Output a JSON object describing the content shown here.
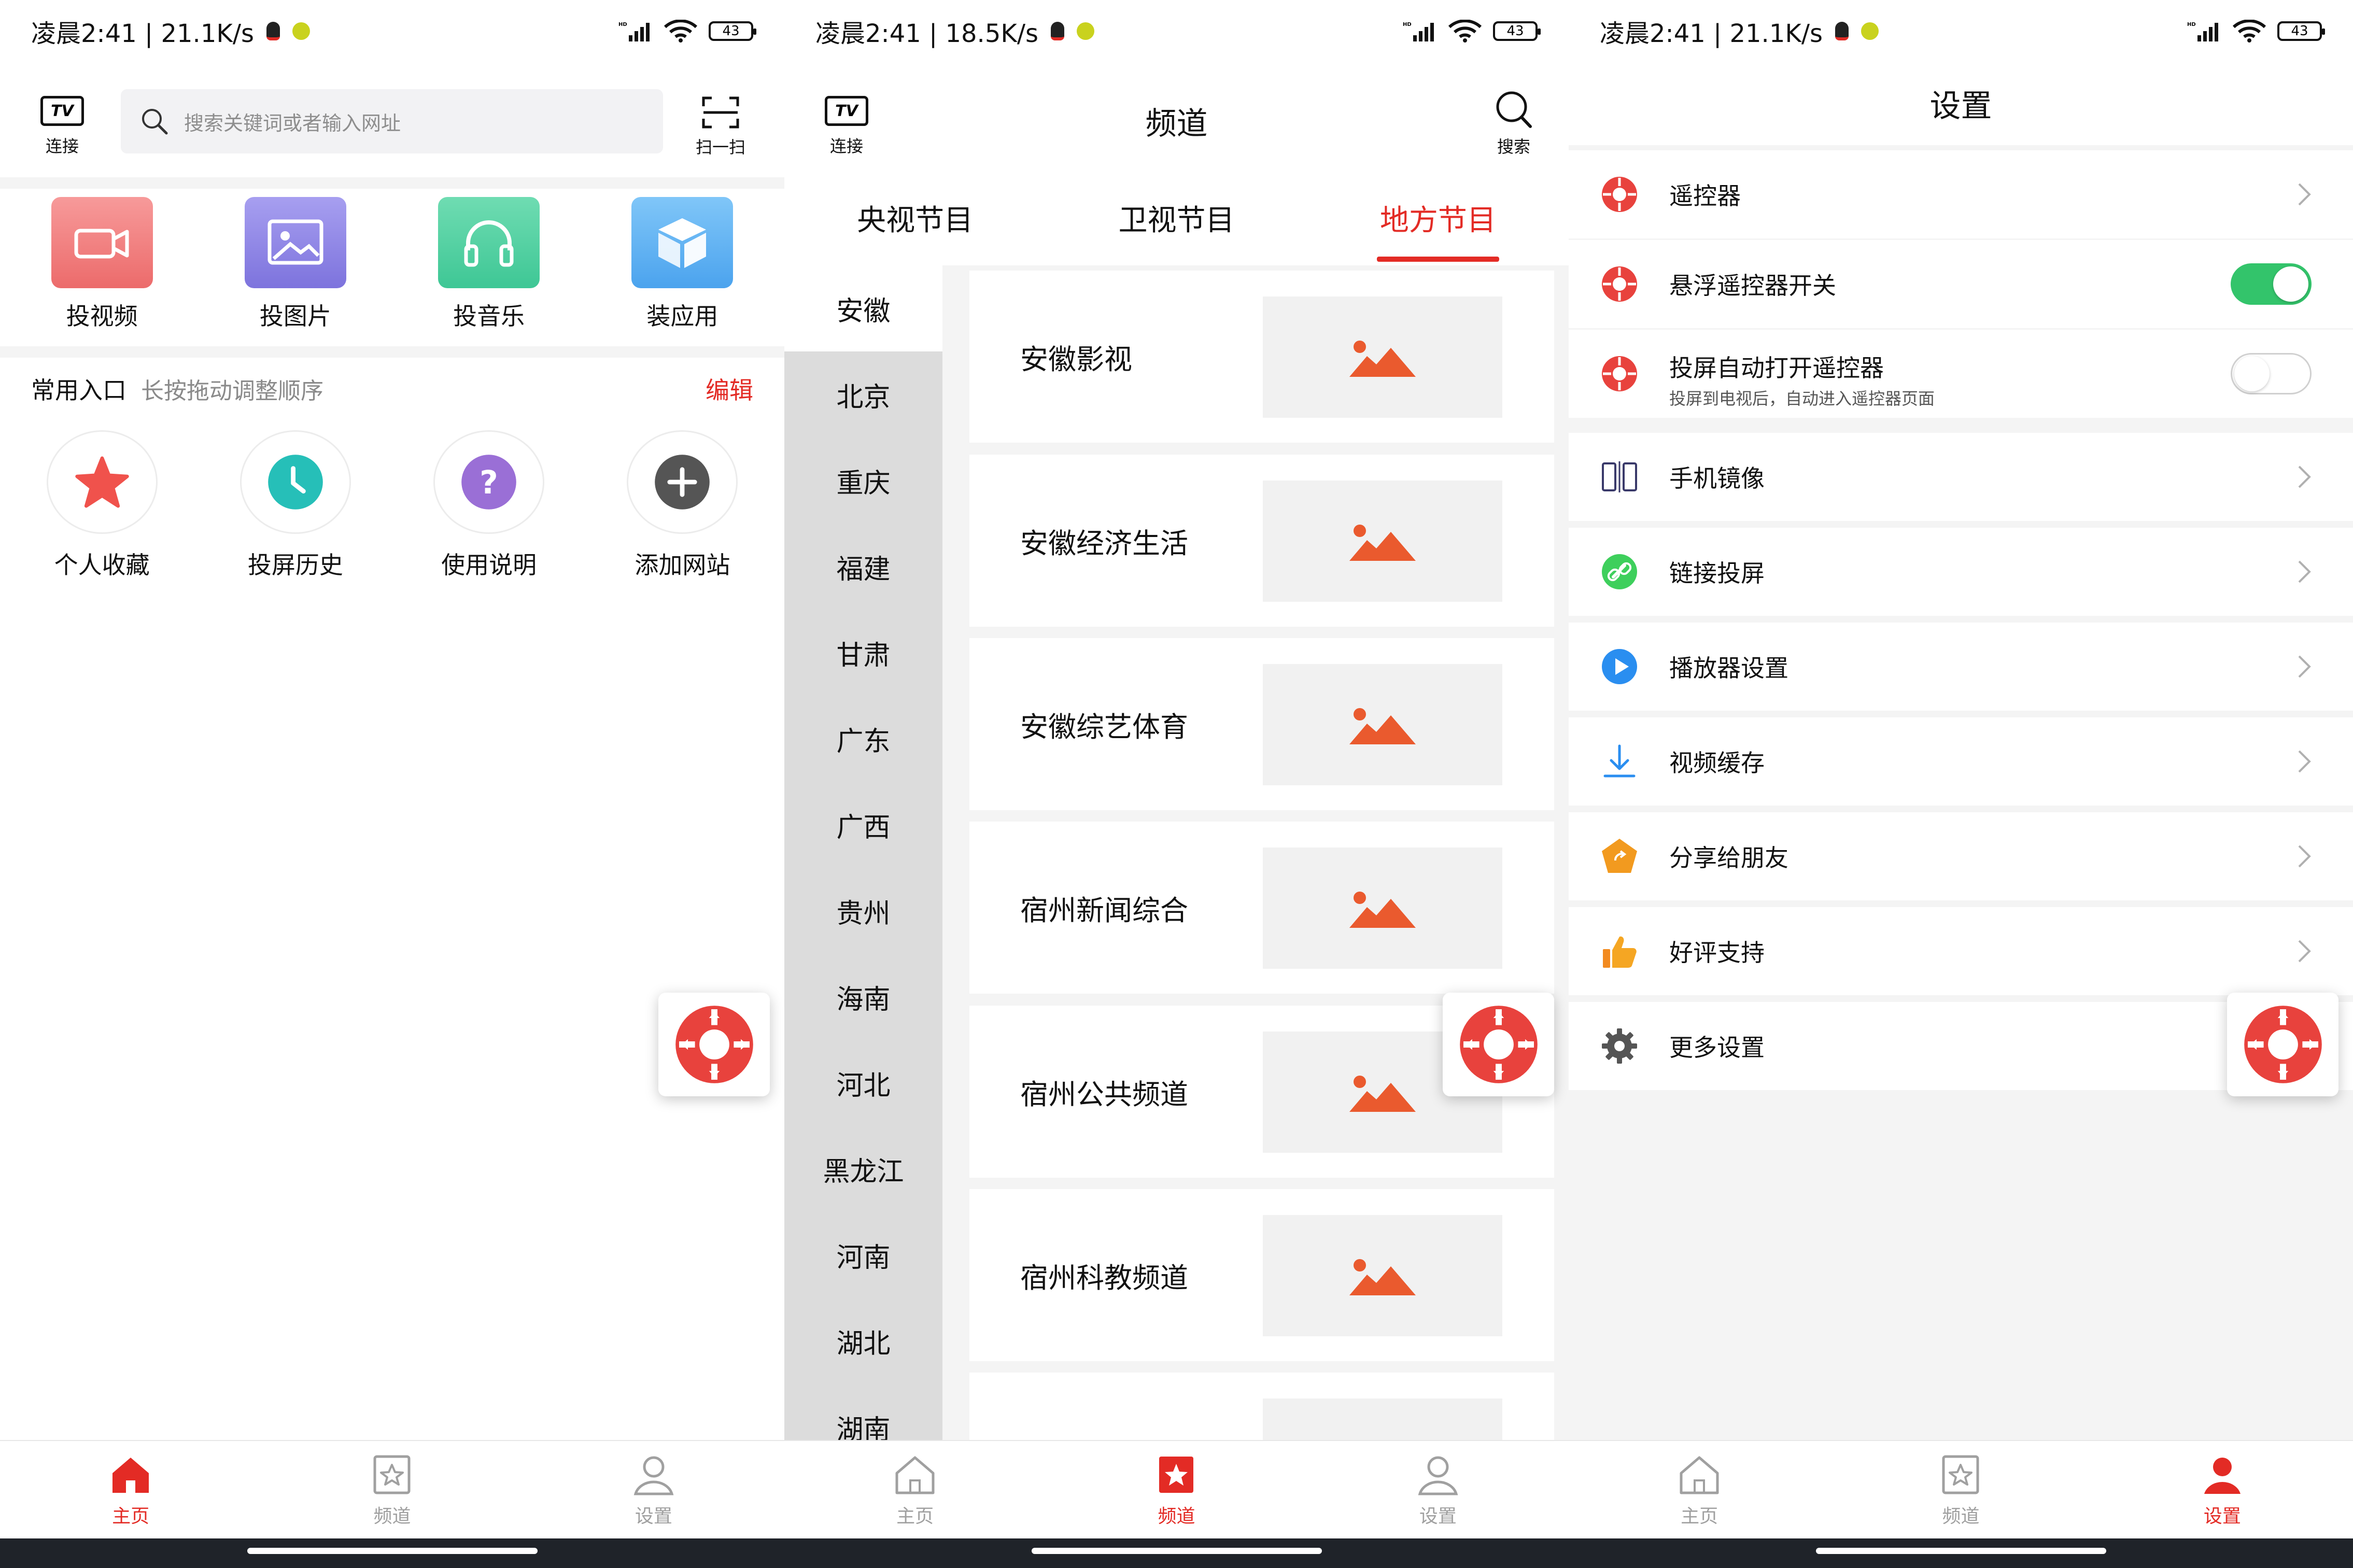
{
  "status_bars": [
    {
      "text": "凌晨2:41 | 21.1K/s",
      "battery": "43"
    },
    {
      "text": "凌晨2:41 | 18.5K/s",
      "battery": "43"
    },
    {
      "text": "凌晨2:41 | 21.1K/s",
      "battery": "43"
    }
  ],
  "colors": {
    "accent": "#e32b25",
    "toggle_on": "#33c46b"
  },
  "nav": {
    "home": "主页",
    "channel": "频道",
    "settings": "设置"
  },
  "home": {
    "tv_label": "TV",
    "connect_label": "连接",
    "search_placeholder": "搜索关键词或者输入网址",
    "scan_label": "扫一扫",
    "cast_items": [
      {
        "label": "投视频",
        "icon": "video-camera-icon",
        "color": "#ef7a7a"
      },
      {
        "label": "投图片",
        "icon": "image-icon",
        "color": "#8f86e6"
      },
      {
        "label": "投音乐",
        "icon": "headphones-icon",
        "color": "#56d1a4"
      },
      {
        "label": "装应用",
        "icon": "box-icon",
        "color": "#61b4f3"
      }
    ],
    "common_title": "常用入口",
    "common_hint": "长按拖动调整顺序",
    "edit_label": "编辑",
    "common_items": [
      {
        "label": "个人收藏",
        "icon": "star-icon"
      },
      {
        "label": "投屏历史",
        "icon": "clock-icon"
      },
      {
        "label": "使用说明",
        "icon": "question-icon"
      },
      {
        "label": "添加网站",
        "icon": "plus-icon"
      }
    ]
  },
  "channels": {
    "title": "频道",
    "search_label": "搜索",
    "tabs": [
      "央视节目",
      "卫视节目",
      "地方节目"
    ],
    "active_tab": 2,
    "provinces": [
      "安徽",
      "北京",
      "重庆",
      "福建",
      "甘肃",
      "广东",
      "广西",
      "贵州",
      "海南",
      "河北",
      "黑龙江",
      "河南",
      "湖北",
      "湖南"
    ],
    "active_province": 0,
    "channels": [
      "安徽影视",
      "安徽经济生活",
      "安徽综艺体育",
      "宿州新闻综合",
      "宿州公共频道",
      "宿州科教频道",
      ""
    ]
  },
  "settings": {
    "title": "设置",
    "rows": [
      {
        "label": "遥控器",
        "icon": "remote-icon",
        "control": "chevron"
      },
      {
        "label": "悬浮遥控器开关",
        "icon": "remote-icon",
        "control": "toggle-on"
      },
      {
        "label": "投屏自动打开遥控器",
        "sub": "投屏到电视后，自动进入遥控器页面",
        "icon": "remote-icon",
        "control": "toggle-off"
      },
      {
        "label": "手机镜像",
        "icon": "mirror-icon",
        "control": "chevron"
      },
      {
        "label": "链接投屏",
        "icon": "link-icon",
        "control": "chevron"
      },
      {
        "label": "播放器设置",
        "icon": "play-icon",
        "control": "chevron"
      },
      {
        "label": "视频缓存",
        "icon": "download-icon",
        "control": "chevron"
      },
      {
        "label": "分享给朋友",
        "icon": "share-icon",
        "control": "chevron"
      },
      {
        "label": "好评支持",
        "icon": "thumbs-up-icon",
        "control": "chevron"
      },
      {
        "label": "更多设置",
        "icon": "gear-icon",
        "control": "none"
      }
    ]
  }
}
